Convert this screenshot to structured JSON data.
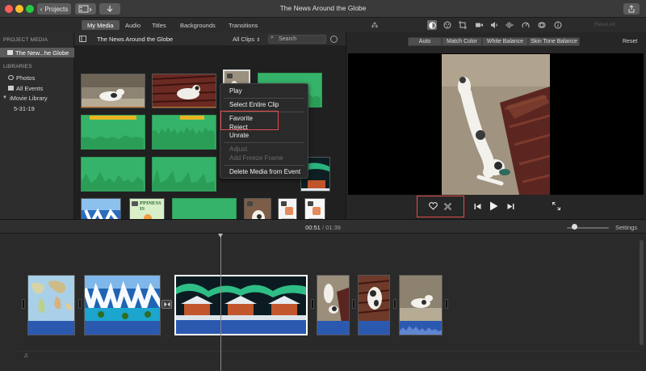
{
  "window": {
    "title": "The News Around the Globe",
    "projects_label": "Projects",
    "traffic_lights": [
      "#fe5f57",
      "#febc2e",
      "#28c840"
    ]
  },
  "tabs": [
    "My Media",
    "Audio",
    "Titles",
    "Backgrounds",
    "Transitions"
  ],
  "active_tab": "My Media",
  "sidebar": {
    "project_heading": "PROJECT MEDIA",
    "project_item": "The New...he Globe",
    "libraries_heading": "LIBRARIES",
    "items": [
      "Photos",
      "All Events",
      "iMovie Library",
      "5-31-19"
    ]
  },
  "browser": {
    "title": "The News Around the Globe",
    "filter": "All Clips",
    "search_placeholder": "Search",
    "thumb_caption": "PPINESS IS"
  },
  "context_menu": {
    "items": [
      {
        "label": "Play",
        "enabled": true
      },
      {
        "label": "Select Entire Clip",
        "enabled": true
      },
      {
        "label": "Favorite",
        "enabled": true
      },
      {
        "label": "Reject",
        "enabled": true
      },
      {
        "label": "Unrate",
        "enabled": true
      },
      {
        "label": "Adjust",
        "enabled": false
      },
      {
        "label": "Add Freeze Frame",
        "enabled": false
      },
      {
        "label": "Delete Media from Event",
        "enabled": true
      }
    ]
  },
  "viewer": {
    "reset_all": "Reset All",
    "reset": "Reset",
    "color_buttons": [
      "Auto",
      "Match Color",
      "White Balance",
      "Skin Tone Balance"
    ]
  },
  "timeline": {
    "current_time": "00:51",
    "separator": "/",
    "total_time": "01:39",
    "settings_label": "Settings",
    "zoom_level": 0.12
  },
  "colors": {
    "highlight": "#e34c4c",
    "clip_green": "#36b36a",
    "audio_blue": "#2c59b0",
    "marker_yellow": "#e8b622"
  }
}
